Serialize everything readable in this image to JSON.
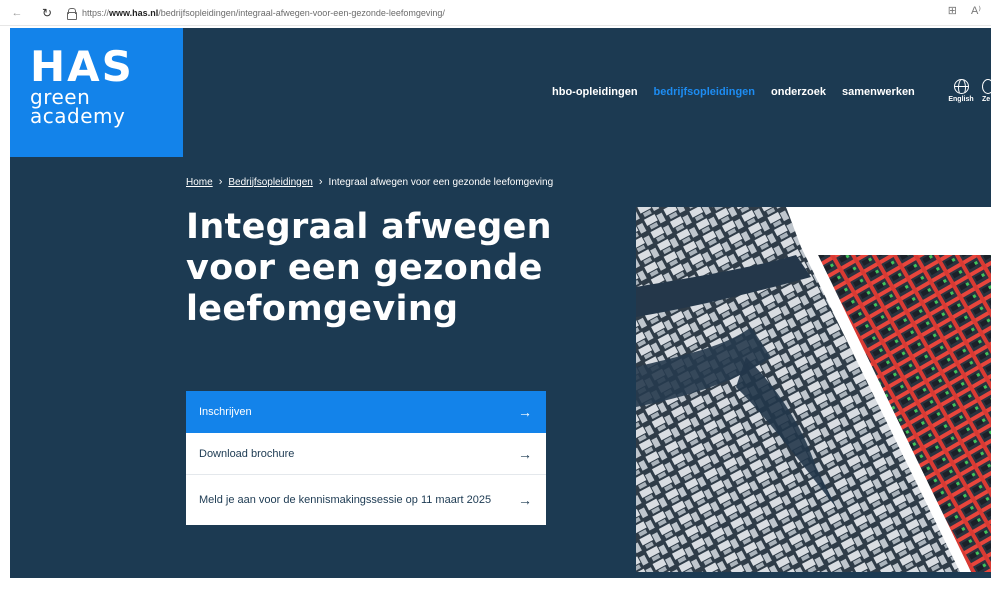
{
  "browser": {
    "url_prefix": "https://",
    "url_host": "www.has.nl",
    "url_path": "/bedrijfsopleidingen/integraal-afwegen-voor-een-gezonde-leefomgeving/"
  },
  "logo": {
    "line1": "HAS",
    "line2": "green",
    "line3": "academy"
  },
  "nav": {
    "items": [
      {
        "label": "hbo-opleidingen"
      },
      {
        "label": "bedrijfsopleidingen"
      },
      {
        "label": "onderzoek"
      },
      {
        "label": "samenwerken"
      }
    ],
    "language_label": "English",
    "cut_label": "Ze"
  },
  "breadcrumb": {
    "home": "Home",
    "section": "Bedrijfsopleidingen",
    "current": "Integraal afwegen voor een gezonde leefomgeving"
  },
  "hero": {
    "title": "Integraal afwegen voor een gezonde leefomgeving"
  },
  "cta": {
    "primary": "Inschrijven",
    "secondary": "Download brochure",
    "third": "Meld je aan voor de kennismakingssessie op 11 maart 2025"
  },
  "colors": {
    "brand_blue": "#1383ea",
    "navy": "#1c3a52",
    "active_nav": "#1d8cf2"
  }
}
